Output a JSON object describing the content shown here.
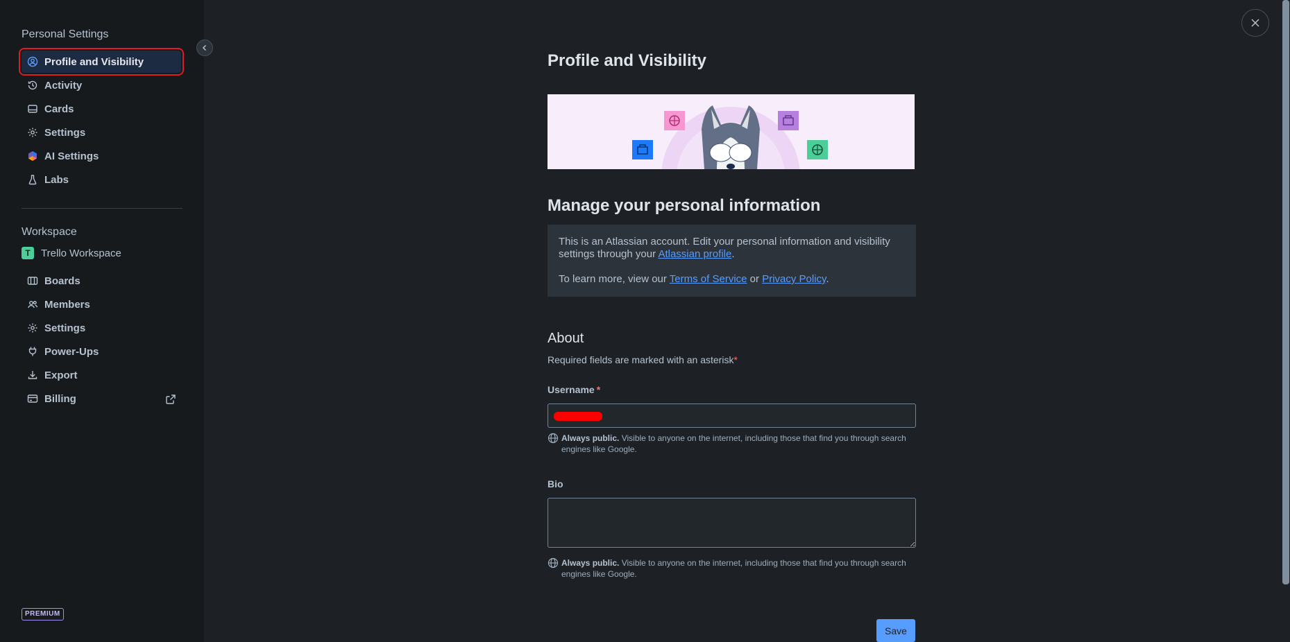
{
  "sidebar": {
    "personal_title": "Personal Settings",
    "personal_items": [
      {
        "label": "Profile and Visibility",
        "icon": "person-circle-icon",
        "active": true
      },
      {
        "label": "Activity",
        "icon": "history-icon"
      },
      {
        "label": "Cards",
        "icon": "card-icon"
      },
      {
        "label": "Settings",
        "icon": "gear-icon"
      },
      {
        "label": "AI Settings",
        "icon": "ai-atlassian-icon"
      },
      {
        "label": "Labs",
        "icon": "flask-icon"
      }
    ],
    "workspace_title": "Workspace",
    "workspace_name": "Trello Workspace",
    "workspace_initial": "T",
    "workspace_items": [
      {
        "label": "Boards",
        "icon": "board-icon"
      },
      {
        "label": "Members",
        "icon": "people-icon"
      },
      {
        "label": "Settings",
        "icon": "gear-icon"
      },
      {
        "label": "Power-Ups",
        "icon": "plug-icon"
      },
      {
        "label": "Export",
        "icon": "download-icon"
      },
      {
        "label": "Billing",
        "icon": "credit-card-icon",
        "external": true
      }
    ],
    "premium_badge": "PREMIUM"
  },
  "main": {
    "title": "Profile and Visibility",
    "manage_heading": "Manage your personal information",
    "info": {
      "line1_before": "This is an Atlassian account. Edit your personal information and visibility settings through your ",
      "atlassian_link": "Atlassian profile",
      "line1_after": ".",
      "line2_before": "To learn more, view our ",
      "terms_link": "Terms of Service",
      "or": " or ",
      "privacy_link": "Privacy Policy",
      "line2_after": "."
    },
    "about_heading": "About",
    "required_note": "Required fields are marked with an asterisk",
    "asterisk": "*",
    "username_label": "Username",
    "username_value": "",
    "bio_label": "Bio",
    "bio_value": "",
    "helper_bold": "Always public.",
    "helper_text": " Visible to anyone on the internet, including those that find you through search engines like Google.",
    "save_label": "Save"
  },
  "colors": {
    "accent": "#579dff",
    "highlight_outline": "#e01c22",
    "background": "#1d2125",
    "sidebar": "#161a1d"
  }
}
